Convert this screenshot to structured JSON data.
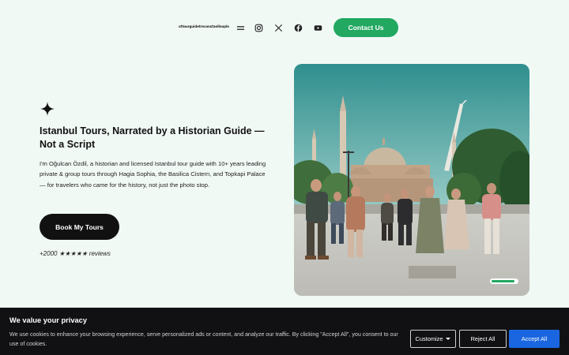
{
  "header": {
    "logo": "ottourguidetrnconstanllnople",
    "icons": [
      "menu-icon",
      "instagram-icon",
      "x-icon",
      "facebook-icon",
      "youtube-icon"
    ],
    "contact_label": "Contact Us"
  },
  "hero": {
    "title": "Istanbul Tours, Narrated by a Historian Guide — Not a Script",
    "description": "I'm Oğulcan Özdil, a historian and licensed Istanbul tour guide with 10+ years leading private & group tours through Hagia Sophia, the Basilica Cistern, and Topkapi Palace — for travelers who came for the history, not just the photo stop.",
    "cta_label": "Book My Tours",
    "reviews_text": "+2000 ★★★★★ reviews",
    "slider_progress": 0.9
  },
  "cookie_banner": {
    "title": "We value your privacy",
    "text": "We use cookies to enhance your browsing experience, serve personalized ads or content, and analyze our traffic. By clicking \"Accept All\", you consent to our use of cookies.",
    "customize_label": "Customize",
    "reject_label": "Reject All",
    "accept_label": "Accept All"
  },
  "colors": {
    "brand_green": "#22a861",
    "accept_blue": "#1a66e0",
    "page_background": "#f1f9f5"
  }
}
